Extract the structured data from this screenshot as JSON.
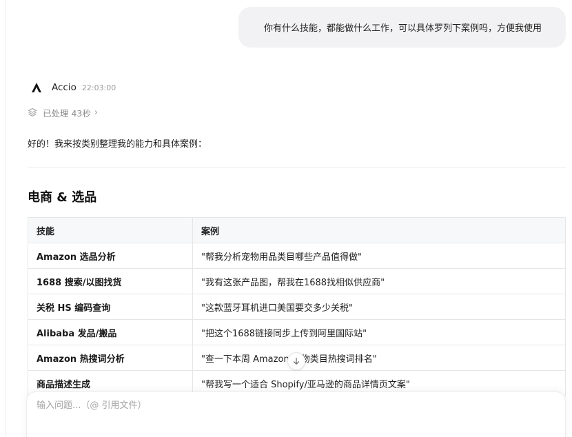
{
  "user_message": "你有什么技能，都能做什么工作，可以具体罗列下案例吗，方便我使用",
  "agent": {
    "name": "Accio",
    "time": "22:03:00",
    "logo_icon": "accio-logo-icon",
    "processed": "已处理 43秒",
    "processed_chevron": "›"
  },
  "intro": "好的！我来按类别整理我的能力和具体案例：",
  "section": {
    "title": "电商 & 选品",
    "columns": [
      "技能",
      "案例"
    ],
    "rows": [
      {
        "skill": "Amazon 选品分析",
        "example": "\"帮我分析宠物用品类目哪些产品值得做\""
      },
      {
        "skill": "1688 搜索/以图找货",
        "example": "\"我有这张产品图，帮我在1688找相似供应商\""
      },
      {
        "skill": "关税 HS 编码查询",
        "example": "\"这款蓝牙耳机进口美国要交多少关税\""
      },
      {
        "skill": "Alibaba 发品/搬品",
        "example": "\"把这个1688链接同步上传到阿里国际站\""
      },
      {
        "skill": "Amazon 热搜词分析",
        "example": "\"查一下本周 Amazon 宠物类目热搜词排名\""
      },
      {
        "skill": "商品描述生成",
        "example": "\"帮我写一个适合 Shopify/亚马逊的商品详情页文案\""
      }
    ]
  },
  "composer": {
    "placeholder": "输入问题...（@ 引用文件）"
  },
  "colors": {
    "bubble_bg": "#f2f2f4",
    "table_header_bg": "#f7f8fa",
    "border": "#e6e6e6",
    "muted_text": "#8c8c8c"
  }
}
